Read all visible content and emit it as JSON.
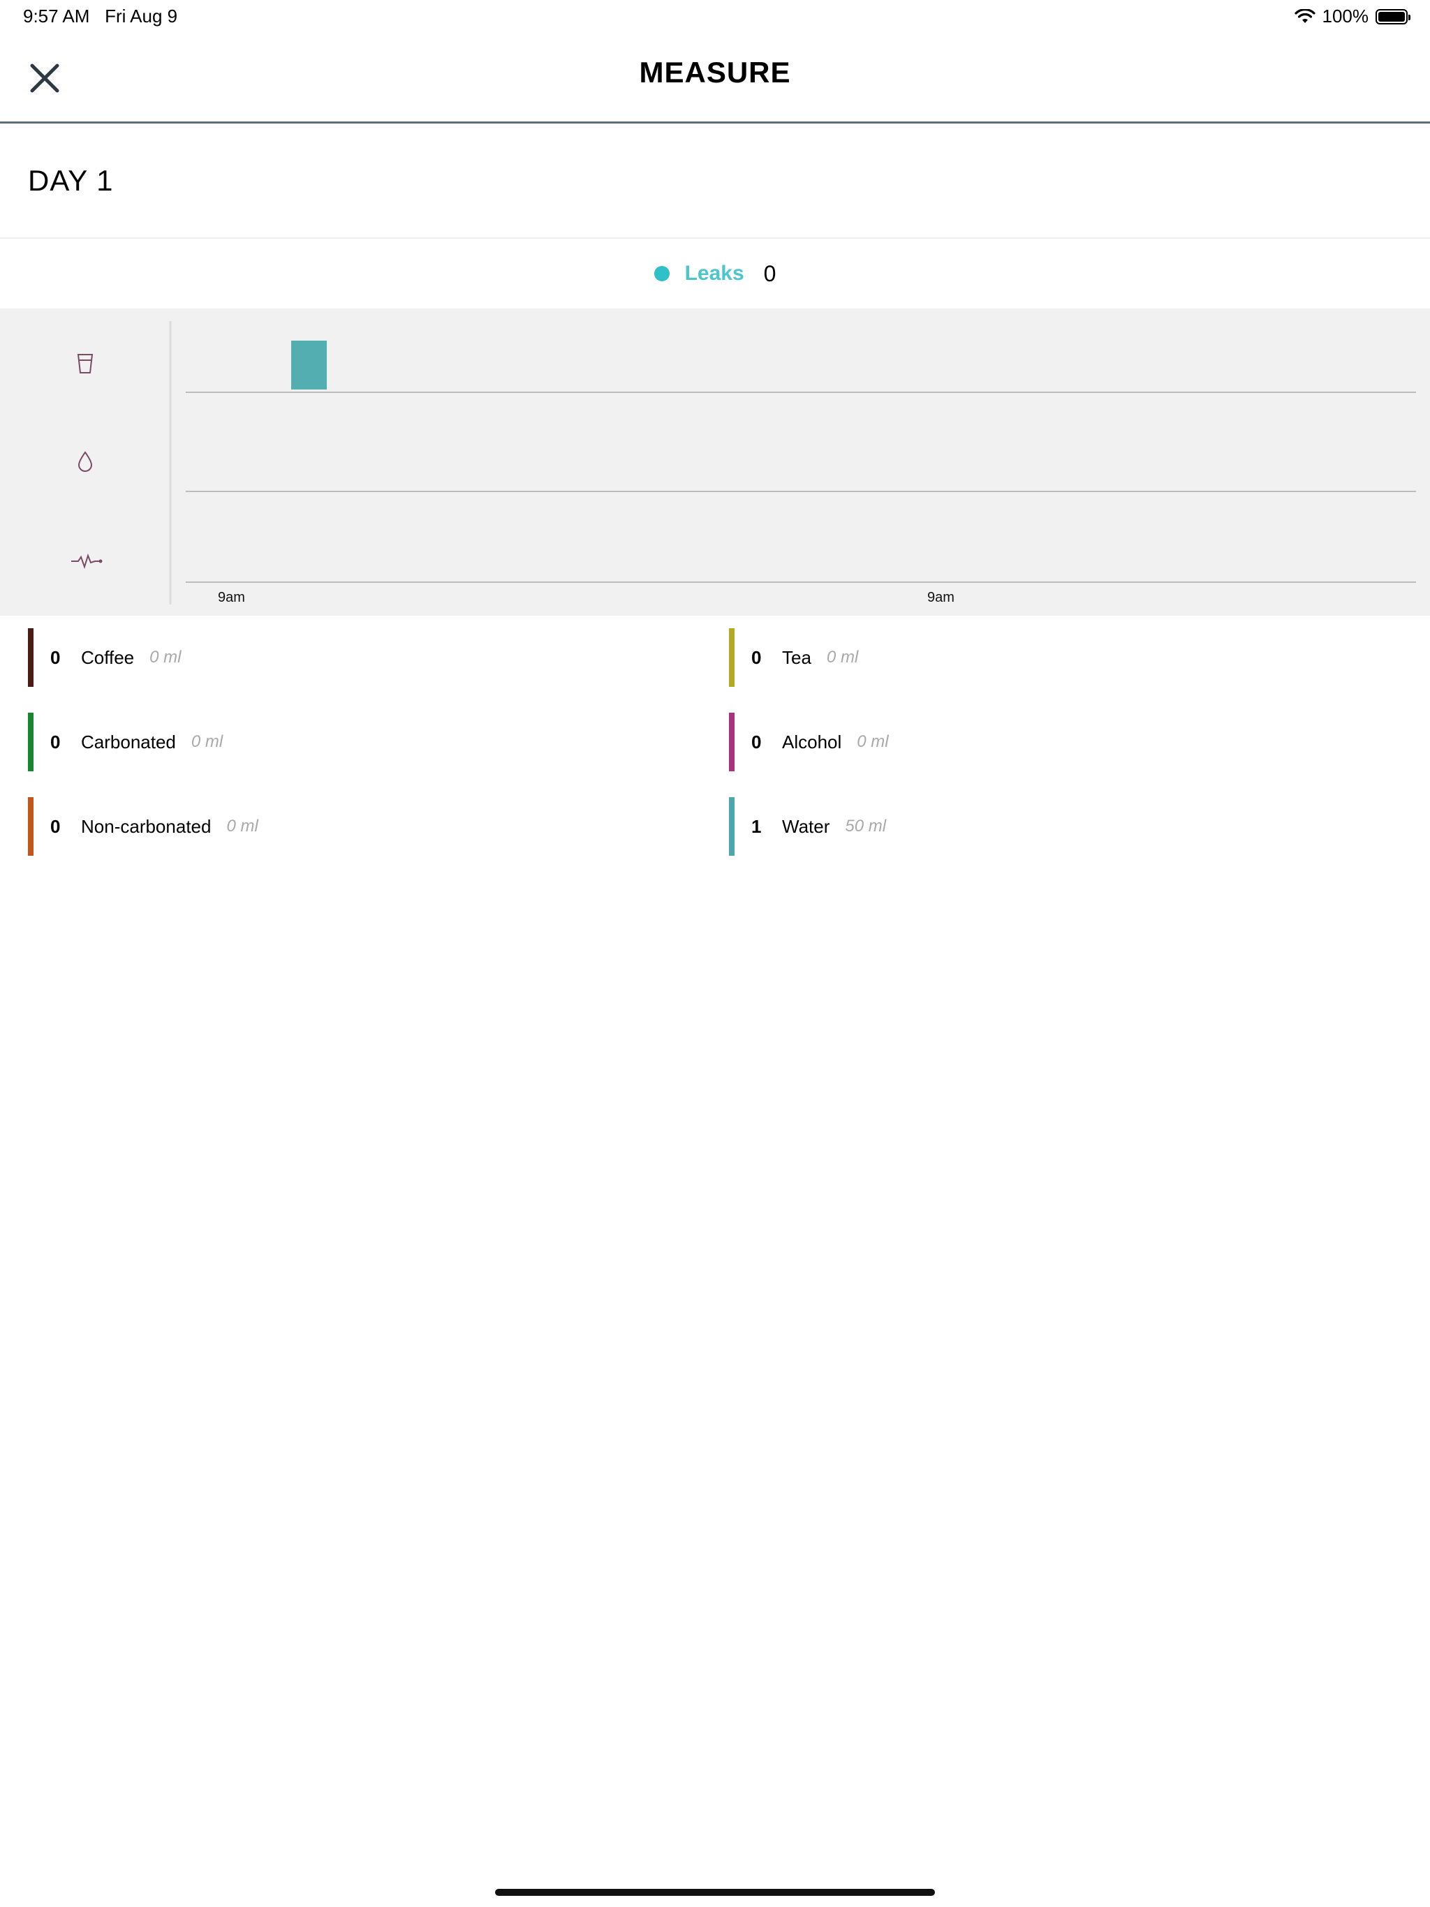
{
  "status_bar": {
    "time": "9:57 AM",
    "date": "Fri Aug 9",
    "battery": "100%"
  },
  "header": {
    "title": "MEASURE",
    "close_icon": "close-icon"
  },
  "day": {
    "title": "DAY 1"
  },
  "legend": {
    "label": "Leaks",
    "count": "0",
    "color": "#2fc1c7"
  },
  "chart_data": {
    "type": "bar",
    "rows": [
      {
        "icon": "cup-icon",
        "bars": [
          {
            "start": "9:10am",
            "color": "#52aeb0"
          }
        ]
      },
      {
        "icon": "drop-icon",
        "bars": []
      },
      {
        "icon": "pulse-icon",
        "bars": []
      }
    ],
    "x_tick_labels": [
      "9am",
      "9am"
    ]
  },
  "drinks": [
    {
      "count": "0",
      "name": "Coffee",
      "amount": "0 ml",
      "color": "#4a1c14"
    },
    {
      "count": "0",
      "name": "Tea",
      "amount": "0 ml",
      "color": "#b2a927"
    },
    {
      "count": "0",
      "name": "Carbonated",
      "amount": "0 ml",
      "color": "#17862f"
    },
    {
      "count": "0",
      "name": "Alcohol",
      "amount": "0 ml",
      "color": "#a8327b"
    },
    {
      "count": "0",
      "name": "Non-carbonated",
      "amount": "0 ml",
      "color": "#c2571a"
    },
    {
      "count": "1",
      "name": "Water",
      "amount": "50 ml",
      "color": "#4aa7ab"
    }
  ]
}
